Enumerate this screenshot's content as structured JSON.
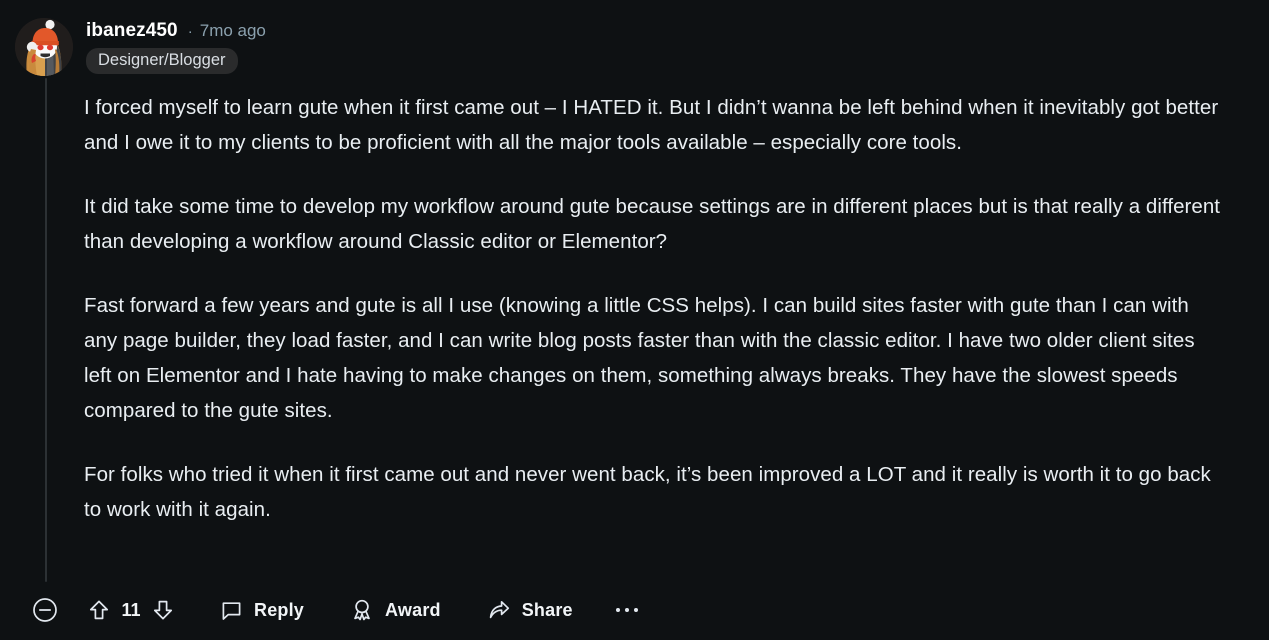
{
  "comment": {
    "author": "ibanez450",
    "separator": "·",
    "timestamp": "7mo ago",
    "flair": "Designer/Blogger",
    "avatar_icon": "reddit-snoo-avatar",
    "paragraphs": [
      "I forced myself to learn gute when it first came out – I HATED it. But I didn’t wanna be left behind when it inevitably got better and I owe it to my clients to be proficient with all the major tools available – especially core tools.",
      "It did take some time to develop my workflow around gute because settings are in different places but is that really a different than developing a workflow around Classic editor or Elementor?",
      "Fast forward a few years and gute is all I use (knowing a little CSS helps). I can build sites faster with gute than I can with any page builder, they load faster, and I can write blog posts faster than with the classic editor. I have two older client sites left on Elementor and I hate having to make changes on them, something always breaks. They have the slowest speeds compared to the gute sites.",
      "For folks who tried it when it first came out and never went back, it’s been improved a LOT and it really is worth it to go back to work with it again."
    ]
  },
  "actions": {
    "collapse_icon": "circle-minus-icon",
    "upvote_icon": "upvote-arrow-icon",
    "downvote_icon": "downvote-arrow-icon",
    "vote_count": "11",
    "reply_icon": "comment-bubble-icon",
    "reply_label": "Reply",
    "award_icon": "award-medal-icon",
    "award_label": "Award",
    "share_icon": "share-arrow-icon",
    "share_label": "Share",
    "more_icon": "overflow-dots-icon"
  },
  "colors": {
    "background": "#0e1113",
    "text": "#e9eef2",
    "muted": "#8ba1ae",
    "flair_bg": "#2a2b2c",
    "thread_line": "#2c3134"
  }
}
